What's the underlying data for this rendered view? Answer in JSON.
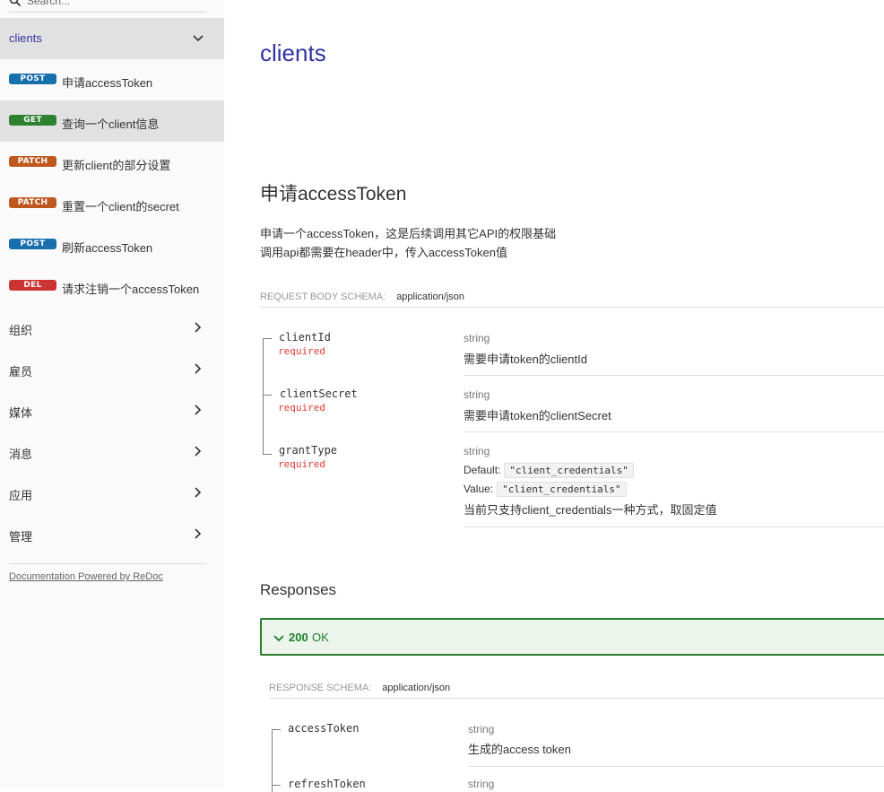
{
  "search": {
    "placeholder": "Search..."
  },
  "sidebar": {
    "group": "clients",
    "operations": [
      {
        "method": "POST",
        "label": "申请accessToken"
      },
      {
        "method": "GET",
        "label": "查询一个client信息"
      },
      {
        "method": "PATCH",
        "label": "更新client的部分设置"
      },
      {
        "method": "PATCH",
        "label": "重置一个client的secret"
      },
      {
        "method": "POST",
        "label": "刷新accessToken"
      },
      {
        "method": "DEL",
        "label": "请求注销一个accessToken"
      }
    ],
    "sections": [
      "组织",
      "雇员",
      "媒体",
      "消息",
      "应用",
      "管理"
    ],
    "powered_by": "Documentation Powered by ReDoc"
  },
  "main": {
    "group_title": "clients",
    "operation_title": "申请accessToken",
    "description": [
      "申请一个accessToken，这是后续调用其它API的权限基础",
      "调用api都需要在header中，传入accessToken值"
    ],
    "request_schema_label": "REQUEST BODY SCHEMA:",
    "request_schema_type": "application/json",
    "request_props": [
      {
        "name": "clientId",
        "required": "required",
        "type": "string",
        "description": "需要申请token的clientId"
      },
      {
        "name": "clientSecret",
        "required": "required",
        "type": "string",
        "description": "需要申请token的clientSecret"
      },
      {
        "name": "grantType",
        "required": "required",
        "type": "string",
        "default_label": "Default:",
        "default_value": "\"client_credentials\"",
        "value_label": "Value:",
        "value_value": "\"client_credentials\"",
        "description": "当前只支持client_credentials一种方式，取固定值"
      }
    ],
    "responses_title": "Responses",
    "response_code": "200",
    "response_text": "OK",
    "response_schema_label": "RESPONSE SCHEMA:",
    "response_schema_type": "application/json",
    "response_props": [
      {
        "name": "accessToken",
        "type": "string",
        "description": "生成的access token"
      },
      {
        "name": "refreshToken",
        "type": "string"
      }
    ]
  },
  "colors": {
    "accent": "#32329f",
    "post": "#186fad",
    "get": "#2f8132",
    "patch": "#bf581d",
    "del": "#cc3333",
    "success": "#1d8127"
  }
}
